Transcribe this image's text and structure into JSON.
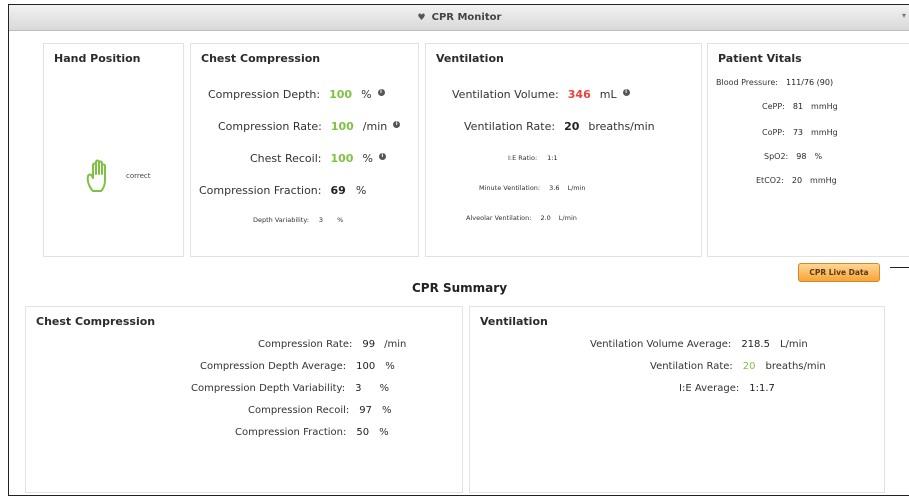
{
  "window": {
    "title": "CPR Monitor"
  },
  "hand_position": {
    "title": "Hand Position",
    "status": "correct",
    "icon": "hand-icon",
    "icon_color": "#7fc241"
  },
  "chest_compression": {
    "title": "Chest Compression",
    "depth": {
      "label": "Compression Depth:",
      "value": "100",
      "unit": "%"
    },
    "rate": {
      "label": "Compression Rate:",
      "value": "100",
      "unit": "/min"
    },
    "recoil": {
      "label": "Chest Recoil:",
      "value": "100",
      "unit": "%"
    },
    "fraction": {
      "label": "Compression Fraction:",
      "value": "69",
      "unit": "%"
    },
    "variability": {
      "label": "Depth Variability:",
      "value": "3",
      "unit": "%"
    }
  },
  "ventilation": {
    "title": "Ventilation",
    "volume": {
      "label": "Ventilation Volume:",
      "value": "346",
      "unit": "mL"
    },
    "rate": {
      "label": "Ventilation Rate:",
      "value": "20",
      "unit": "breaths/min"
    },
    "ie_ratio": {
      "label": "I:E Ratio:",
      "value": "1:1"
    },
    "minute": {
      "label": "Minute Ventilation:",
      "value": "3.6",
      "unit": "L/min"
    },
    "alveolar": {
      "label": "Alveolar Ventilation:",
      "value": "2.0",
      "unit": "L/min"
    }
  },
  "vitals": {
    "title": "Patient Vitals",
    "bp": {
      "label": "Blood Pressure:",
      "value": "111/76 (90)"
    },
    "cepp": {
      "label": "CePP:",
      "value": "81",
      "unit": "mmHg"
    },
    "copp": {
      "label": "CoPP:",
      "value": "73",
      "unit": "mmHg"
    },
    "spo2": {
      "label": "SpO2:",
      "value": "98",
      "unit": "%"
    },
    "etco2": {
      "label": "EtCO2:",
      "value": "20",
      "unit": "mmHg"
    }
  },
  "live_button": {
    "label": "CPR Live Data"
  },
  "summary": {
    "title": "CPR Summary",
    "chest": {
      "title": "Chest Compression",
      "rate": {
        "label": "Compression Rate:",
        "value": "99",
        "unit": "/min"
      },
      "depth_avg": {
        "label": "Compression Depth Average:",
        "value": "100",
        "unit": "%"
      },
      "depth_var": {
        "label": "Compression Depth Variability:",
        "value": "3",
        "unit": "%"
      },
      "recoil": {
        "label": "Compression Recoil:",
        "value": "97",
        "unit": "%"
      },
      "fraction": {
        "label": "Compression Fraction:",
        "value": "50",
        "unit": "%"
      }
    },
    "vent": {
      "title": "Ventilation",
      "volume_avg": {
        "label": "Ventilation Volume Average:",
        "value": "218.5",
        "unit": "L/min"
      },
      "rate": {
        "label": "Ventilation Rate:",
        "value": "20",
        "unit": "breaths/min"
      },
      "ie_avg": {
        "label": "I:E Average:",
        "value": "1:1.7"
      }
    }
  },
  "colors": {
    "good": "#7fc241",
    "alert": "#e8433f",
    "button": "#f7a537"
  }
}
